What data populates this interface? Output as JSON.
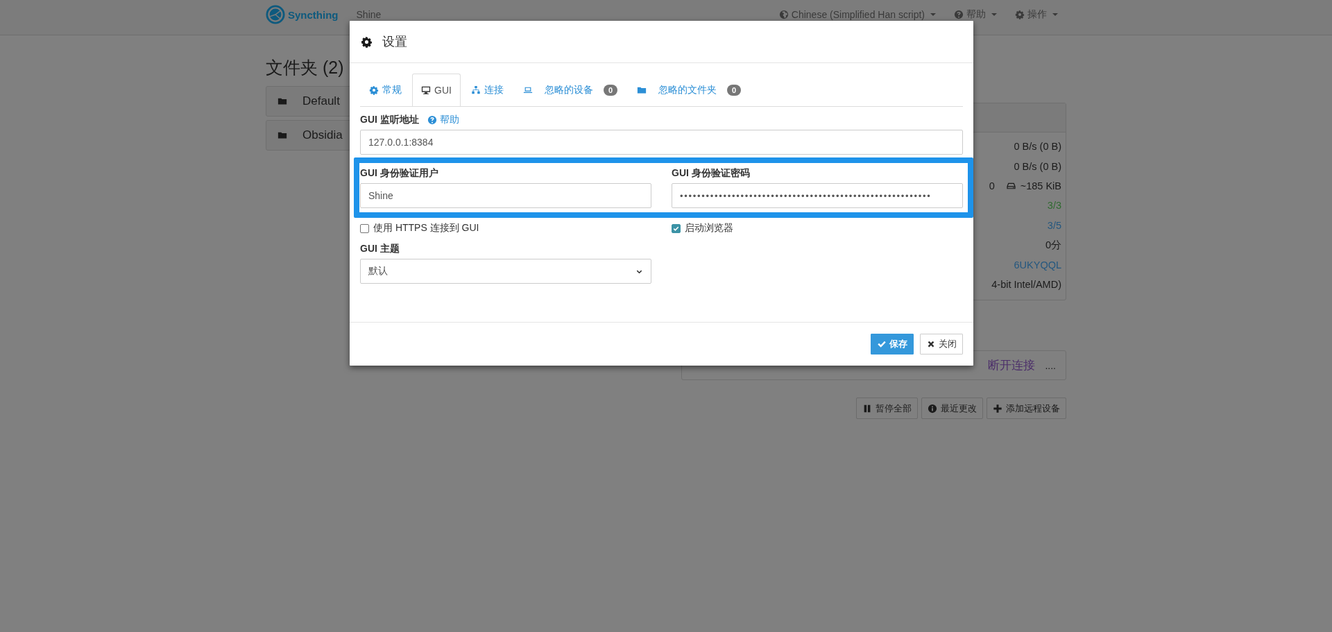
{
  "navbar": {
    "brand": "Syncthing",
    "device_name": "Shine",
    "menus": [
      {
        "label": "Chinese (Simplified Han script)"
      },
      {
        "label": "帮助"
      },
      {
        "label": "操作"
      }
    ]
  },
  "folders": {
    "heading": "文件夹 (2)",
    "items": [
      "Default",
      "Obsidia"
    ]
  },
  "device_stats": [
    {
      "kind": "text",
      "text": "0 B/s (0 B)",
      "color": "#1a1a1a"
    },
    {
      "kind": "text",
      "text": "0 B/s (0 B)",
      "color": "#1a1a1a"
    },
    {
      "kind": "count_size",
      "text": "0",
      "size": "~185 KiB",
      "color": "#1a1a1a"
    },
    {
      "kind": "text",
      "text": "3/3",
      "color": "#2f6a2f"
    },
    {
      "kind": "text",
      "text": "3/5",
      "color": "#24577f"
    },
    {
      "kind": "text",
      "text": "0分",
      "color": "#1a1a1a"
    },
    {
      "kind": "text",
      "text": "6UKYQQL",
      "color": "#24577f"
    },
    {
      "kind": "text",
      "text": "4-bit Intel/AMD)",
      "color": "#1a1a1a"
    }
  ],
  "remote_device": {
    "status": "断开连接",
    "more": "...."
  },
  "actions": [
    {
      "label": "暂停全部"
    },
    {
      "label": "最近更改"
    },
    {
      "label": "添加远程设备"
    }
  ],
  "dialog": {
    "title": "设置",
    "tabs": [
      {
        "label": "常规",
        "selected": false
      },
      {
        "label": "GUI",
        "selected": true
      },
      {
        "label": "连接",
        "selected": false
      },
      {
        "label": "忽略的设备",
        "selected": false,
        "badge": "0"
      },
      {
        "label": "忽略的文件夹",
        "selected": false,
        "badge": "0"
      }
    ],
    "listen_address": {
      "label": "GUI 监听地址",
      "help": "帮助",
      "value": "127.0.0.1:8384"
    },
    "auth": {
      "highlighted": true,
      "user_label": "GUI 身份验证用户",
      "user": "Shine",
      "password_label": "GUI 身份验证密码",
      "password": "••••••••••••••••••••••••••••••••••••••••••••••••••••••••••"
    },
    "options": [
      {
        "label": "使用 HTTPS 连接到 GUI",
        "checked": false
      },
      {
        "label": "启动浏览器",
        "checked": true
      }
    ],
    "theme": {
      "label": "GUI 主题",
      "value": "默认"
    },
    "buttons": [
      {
        "label": "保存",
        "kind": "primary"
      },
      {
        "label": "关闭",
        "kind": "default"
      }
    ]
  }
}
